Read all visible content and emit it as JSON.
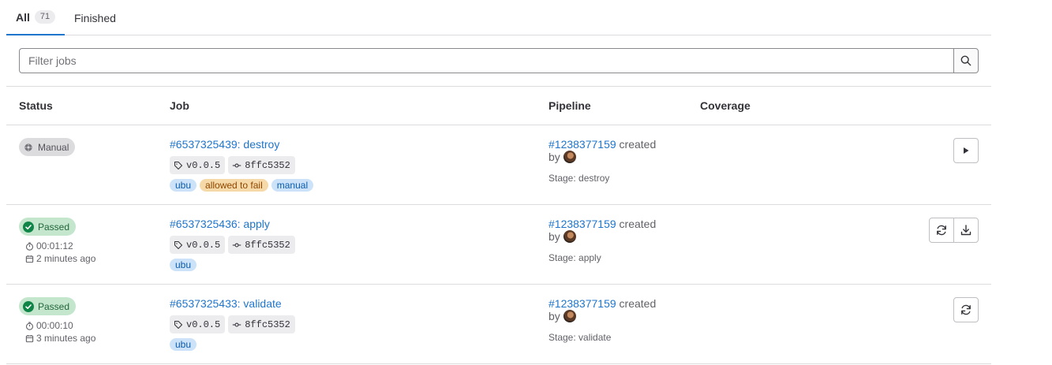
{
  "tabs": [
    {
      "label": "All",
      "count": "71"
    },
    {
      "label": "Finished"
    }
  ],
  "filter": {
    "placeholder": "Filter jobs"
  },
  "table": {
    "headers": {
      "status": "Status",
      "job": "Job",
      "pipeline": "Pipeline",
      "coverage": "Coverage"
    },
    "rows": [
      {
        "status": "Manual",
        "job": "#6537325439: destroy",
        "tag": "v0.0.5",
        "commit": "8ffc5352",
        "labels": [
          "ubu",
          "allowed to fail",
          "manual"
        ],
        "pipeline": "#1238377159",
        "created": "created",
        "by": "by",
        "stage": "Stage: destroy"
      },
      {
        "status": "Passed",
        "duration": "00:01:12",
        "finished": "2 minutes ago",
        "job": "#6537325436: apply",
        "tag": "v0.0.5",
        "commit": "8ffc5352",
        "labels": [
          "ubu"
        ],
        "pipeline": "#1238377159",
        "created": "created",
        "by": "by",
        "stage": "Stage: apply"
      },
      {
        "status": "Passed",
        "duration": "00:00:10",
        "finished": "3 minutes ago",
        "job": "#6537325433: validate",
        "tag": "v0.0.5",
        "commit": "8ffc5352",
        "labels": [
          "ubu"
        ],
        "pipeline": "#1238377159",
        "created": "created",
        "by": "by",
        "stage": "Stage: validate"
      }
    ]
  },
  "colors": {
    "link": "#1f75cb",
    "tab_active": "#1f75cb",
    "passed_bg": "#c3e6cd",
    "passed_icon": "#108548",
    "manual_bg": "#dcdcde",
    "label_blue_bg": "#cbe2f9",
    "label_orange_bg": "#f5d9a8"
  }
}
